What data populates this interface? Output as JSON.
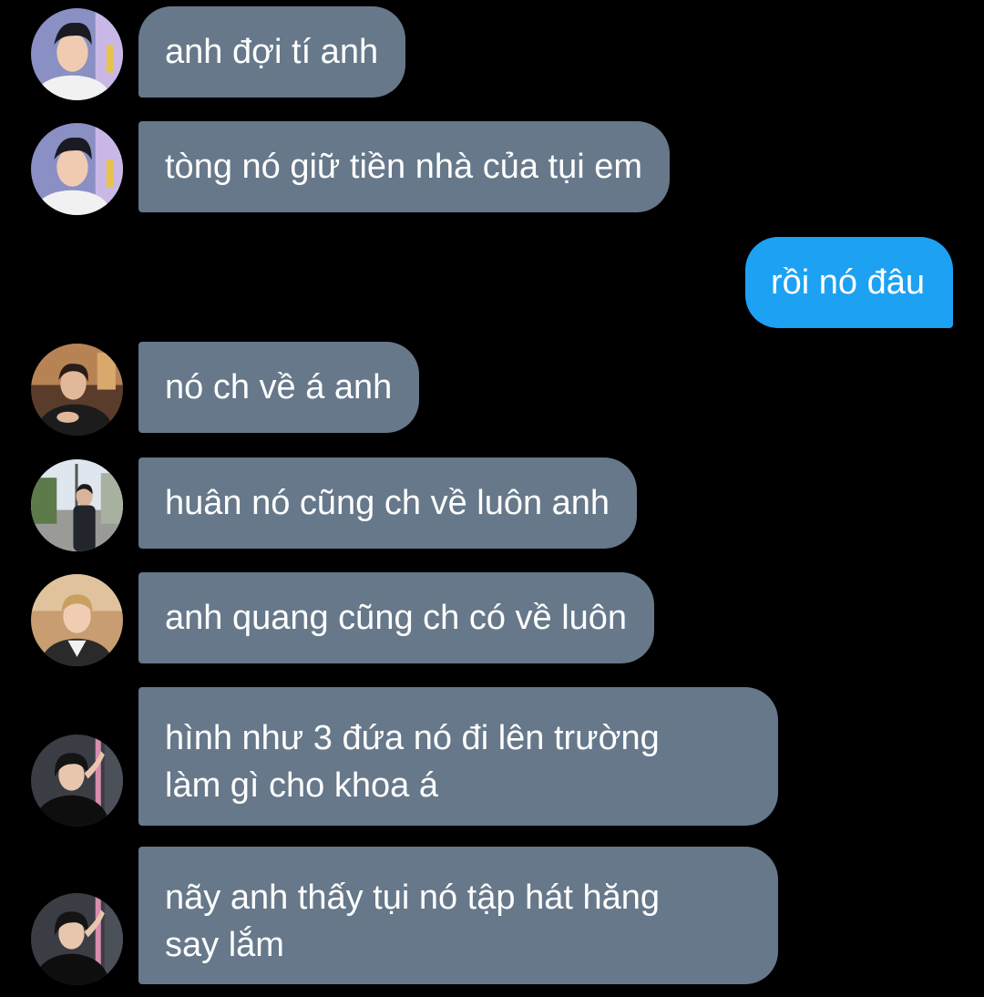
{
  "colors": {
    "background": "#000000",
    "incoming_bubble": "#66788a",
    "outgoing_bubble": "#1da1f2",
    "text": "#ffffff"
  },
  "messages": [
    {
      "direction": "incoming",
      "text": "anh đợi tí anh",
      "avatar": "avatar-photo-smiling-man"
    },
    {
      "direction": "incoming",
      "text": "tòng nó giữ tiền nhà của tụi em",
      "avatar": "avatar-photo-smiling-man"
    },
    {
      "direction": "outgoing",
      "text": "rồi nó đâu"
    },
    {
      "direction": "incoming",
      "text": "nó ch về á anh",
      "avatar": "avatar-photo-man-suit"
    },
    {
      "direction": "incoming",
      "text": "huân nó cũng ch về luôn anh",
      "avatar": "avatar-photo-street"
    },
    {
      "direction": "incoming",
      "text": "anh quang cũng ch có về luôn",
      "avatar": "avatar-photo-man-blonde"
    },
    {
      "direction": "incoming",
      "text": "hình như 3 đứa nó đi lên trường\nlàm gì cho khoa á",
      "avatar": "avatar-photo-black-shirt"
    },
    {
      "direction": "incoming",
      "text": "nãy anh thấy tụi nó tập hát hăng\nsay lắm",
      "avatar": "avatar-photo-black-shirt"
    }
  ]
}
